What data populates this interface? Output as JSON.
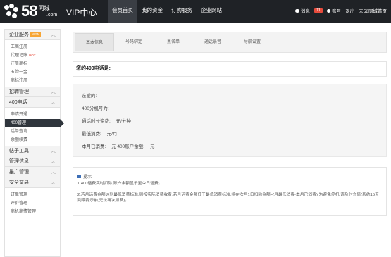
{
  "header": {
    "logo_number": "58",
    "logo_sub": "同城",
    "logo_domain": ".com",
    "vip_title": "VIP中心",
    "nav": [
      "会员首页",
      "我的资金",
      "订购服务",
      "企业网站"
    ],
    "active_nav": 0,
    "messages_label": "消息",
    "messages_count": "11",
    "account_label": "账号",
    "logout_label": "退出",
    "home_label": "去58同城首页"
  },
  "sidebar": {
    "groups": [
      {
        "title": "企业服务",
        "tag": "NEW",
        "items": [
          {
            "label": "工商注册"
          },
          {
            "label": "代理记账",
            "hot": "HOT"
          },
          {
            "label": "注册商标"
          },
          {
            "label": "五险一金"
          },
          {
            "label": "商标注册"
          }
        ]
      },
      {
        "title": "招聘管理",
        "items": []
      },
      {
        "title": "400电话",
        "items": [
          {
            "label": "申请开通"
          },
          {
            "label": "400管理",
            "active": true
          },
          {
            "label": "话单查询"
          },
          {
            "label": "余额续费"
          }
        ]
      },
      {
        "title": "帖子工具",
        "items": []
      },
      {
        "title": "管理信息",
        "items": []
      },
      {
        "title": "推广管理",
        "items": []
      },
      {
        "title": "安全交易",
        "items": [
          {
            "label": "订单管理"
          },
          {
            "label": "评价管理"
          },
          {
            "label": "商机商情管理"
          }
        ]
      }
    ]
  },
  "main": {
    "tabs": [
      "基本信息",
      "号码绑定",
      "黑名单",
      "通话录音",
      "导航设置"
    ],
    "active_tab": 0,
    "phone_label": "您的400电话是:",
    "info": {
      "greeting": "亲爱的:",
      "number_label": "400分机号为:",
      "rate_label": "通话时长资费:",
      "rate_value": "元/分钟",
      "min_label": "最低消费:",
      "min_value": "元/月",
      "used_label": "本月已消费:",
      "used_value": "元",
      "balance_label": "400账户余额:",
      "balance_value": "元"
    },
    "notes": {
      "title": "提示",
      "line1": "1.400话费实时扣除,账户余额显示至今日话费。",
      "line2": "2.若月话费金额达到最低消费标准,则按实际消费收费;若月话费金额低于最低消费标准,将在次月1日扣除金额=(月最低消费-本月已消费),为避免停机,请及时充值(系统15天到期提示前,无法再次扣费)。"
    }
  }
}
